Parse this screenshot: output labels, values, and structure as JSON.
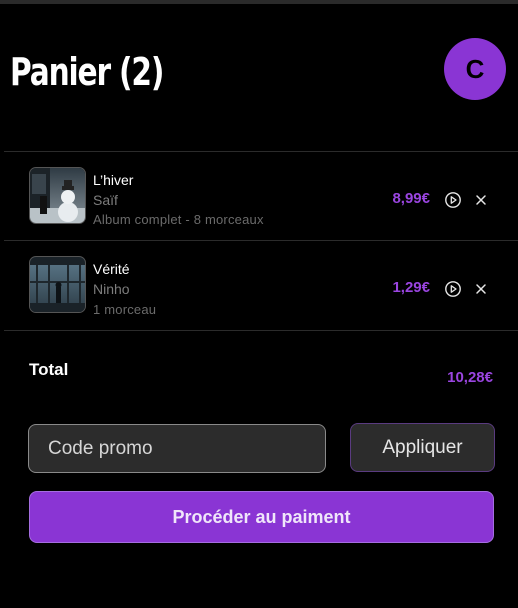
{
  "header": {
    "title": "Panier (2)",
    "avatar_initial": "C"
  },
  "cart": {
    "items": [
      {
        "title": "L’hiver",
        "artist": "Saïf",
        "meta": "Album complet - 8 morceaux",
        "price": "8,99€",
        "cover_icon": "snowman-cover-art"
      },
      {
        "title": "Vérité",
        "artist": "Ninho",
        "meta": "1 morceau",
        "price": "1,29€",
        "cover_icon": "window-silhouette-cover-art"
      }
    ]
  },
  "summary": {
    "total_label": "Total",
    "total_value": "10,28€"
  },
  "promo": {
    "placeholder": "Code promo",
    "value": "",
    "apply_label": "Appliquer"
  },
  "checkout": {
    "label": "Procéder au paiment"
  },
  "colors": {
    "accent": "#8a35d4",
    "price": "#9a45e0",
    "background": "#000000",
    "input_bg": "#2c2c2c"
  }
}
